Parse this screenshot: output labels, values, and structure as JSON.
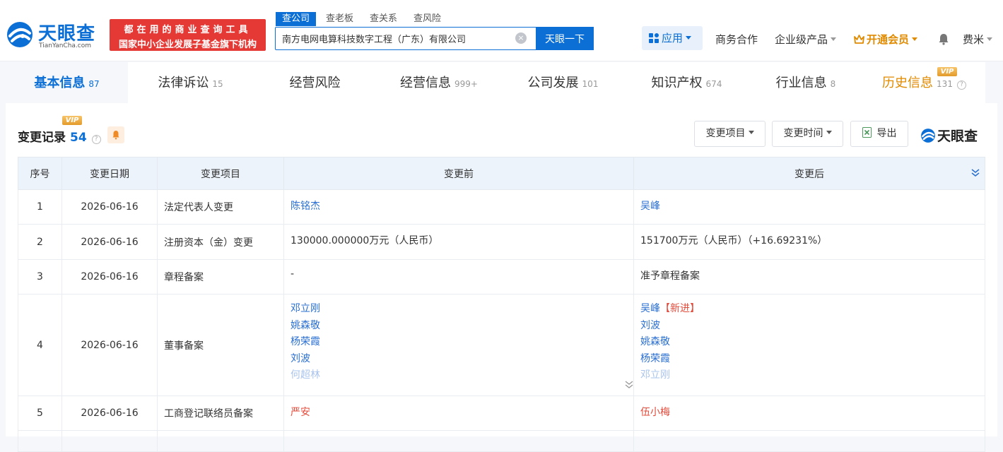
{
  "header": {
    "logo_cn": "天眼查",
    "logo_en": "TianYanCha.com",
    "slogan_line1": "都在用的商业查询工具",
    "slogan_line2": "国家中小企业发展子基金旗下机构",
    "search_tabs": [
      "查公司",
      "查老板",
      "查关系",
      "查风险"
    ],
    "search_value": "南方电网电算科技数字工程（广东）有限公司",
    "search_button": "天眼一下",
    "clear_glyph": "×",
    "app_label": "应用",
    "nav_business": "商务合作",
    "nav_enterprise": "企业级产品",
    "nav_vip": "开通会员",
    "nav_user": "费米"
  },
  "tabs": [
    {
      "label": "基本信息",
      "count": "87"
    },
    {
      "label": "法律诉讼",
      "count": "15"
    },
    {
      "label": "经营风险",
      "count": ""
    },
    {
      "label": "经营信息",
      "count": "999+"
    },
    {
      "label": "公司发展",
      "count": "101"
    },
    {
      "label": "知识产权",
      "count": "674"
    },
    {
      "label": "行业信息",
      "count": "8"
    },
    {
      "label": "历史信息",
      "count": "131"
    }
  ],
  "vip_label": "VIP",
  "help_glyph": "?",
  "section": {
    "title": "变更记录",
    "count": "54",
    "filter_item": "变更项目",
    "filter_time": "变更时间",
    "export": "导出",
    "brand": "天眼查"
  },
  "table": {
    "headers": [
      "序号",
      "变更日期",
      "变更项目",
      "变更前",
      "变更后"
    ],
    "rows": [
      {
        "no": "1",
        "date": "2026-06-16",
        "item": "法定代表人变更",
        "before": [
          "陈铭杰"
        ],
        "after": [
          "吴峰"
        ]
      },
      {
        "no": "2",
        "date": "2026-06-16",
        "item": "注册资本（金）变更",
        "before": [
          "130000.000000万元（人民币）"
        ],
        "after": [
          "151700万元（人民币）（+16.69231%）"
        ]
      },
      {
        "no": "3",
        "date": "2026-06-16",
        "item": "章程备案",
        "before": [
          "-"
        ],
        "after": [
          "准予章程备案"
        ]
      },
      {
        "no": "4",
        "date": "2026-06-16",
        "item": "董事备案",
        "before": [
          "邓立刚",
          "姚森敬",
          "杨荣霞",
          "刘波",
          "何超林"
        ],
        "after_first": "吴峰",
        "after_first_tag": "【新进】",
        "after": [
          "刘波",
          "姚森敬",
          "杨荣霞",
          "邓立刚"
        ]
      },
      {
        "no": "5",
        "date": "2026-06-16",
        "item": "工商登记联络员备案",
        "before": [
          "严安"
        ],
        "after": [
          "伍小梅"
        ]
      }
    ]
  },
  "colors": {
    "brand_blue": "#0b6fd6",
    "slogan_red": "#e53935",
    "vip_orange": "#e08a00",
    "link_blue": "#2a6fd1",
    "change_red": "#e24b3b"
  }
}
